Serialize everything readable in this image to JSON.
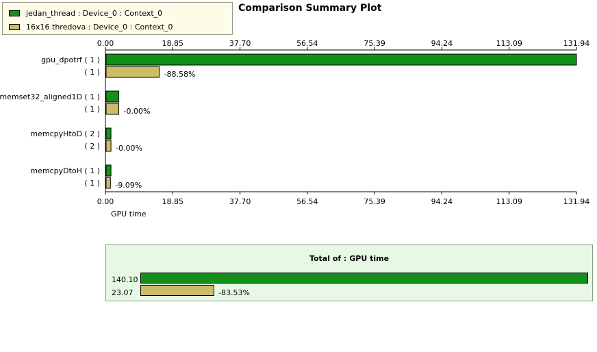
{
  "colors": {
    "series1": "#14901a",
    "series2": "#cdbb6a"
  },
  "legend": [
    {
      "label": "jedan_thread : Device_0 : Context_0",
      "color": "#14901a"
    },
    {
      "label": "16x16 thredova : Device_0 : Context_0",
      "color": "#cdbb6a"
    }
  ],
  "chart_data": {
    "type": "bar",
    "orientation": "horizontal",
    "title": "Comparison Summary Plot",
    "xlabel": "GPU time",
    "xlim": [
      0,
      131.94
    ],
    "xticks": [
      "0.00",
      "18.85",
      "37.70",
      "56.54",
      "75.39",
      "94.24",
      "113.09",
      "131.94"
    ],
    "categories": [
      {
        "label": "gpu_dpotrf ( 1 )",
        "count2": "( 1 )",
        "v1": 131.94,
        "v2": 15.07,
        "pct": "-88.58%"
      },
      {
        "label": "memset32_aligned1D ( 1 )",
        "count2": "( 1 )",
        "v1": 3.75,
        "v2": 3.75,
        "pct": "-0.00%"
      },
      {
        "label": "memcpyHtoD ( 2 )",
        "count2": "( 2 )",
        "v1": 1.55,
        "v2": 1.55,
        "pct": "-0.00%"
      },
      {
        "label": "memcpyDtoH ( 1 )",
        "count2": "( 1 )",
        "v1": 1.55,
        "v2": 1.4,
        "pct": "-9.09%"
      }
    ],
    "total": {
      "title": "Total of : GPU time",
      "v1": 140.1,
      "v1_label": "140.10",
      "v2": 23.07,
      "v2_label": "23.07",
      "pct": "-83.53%"
    }
  }
}
